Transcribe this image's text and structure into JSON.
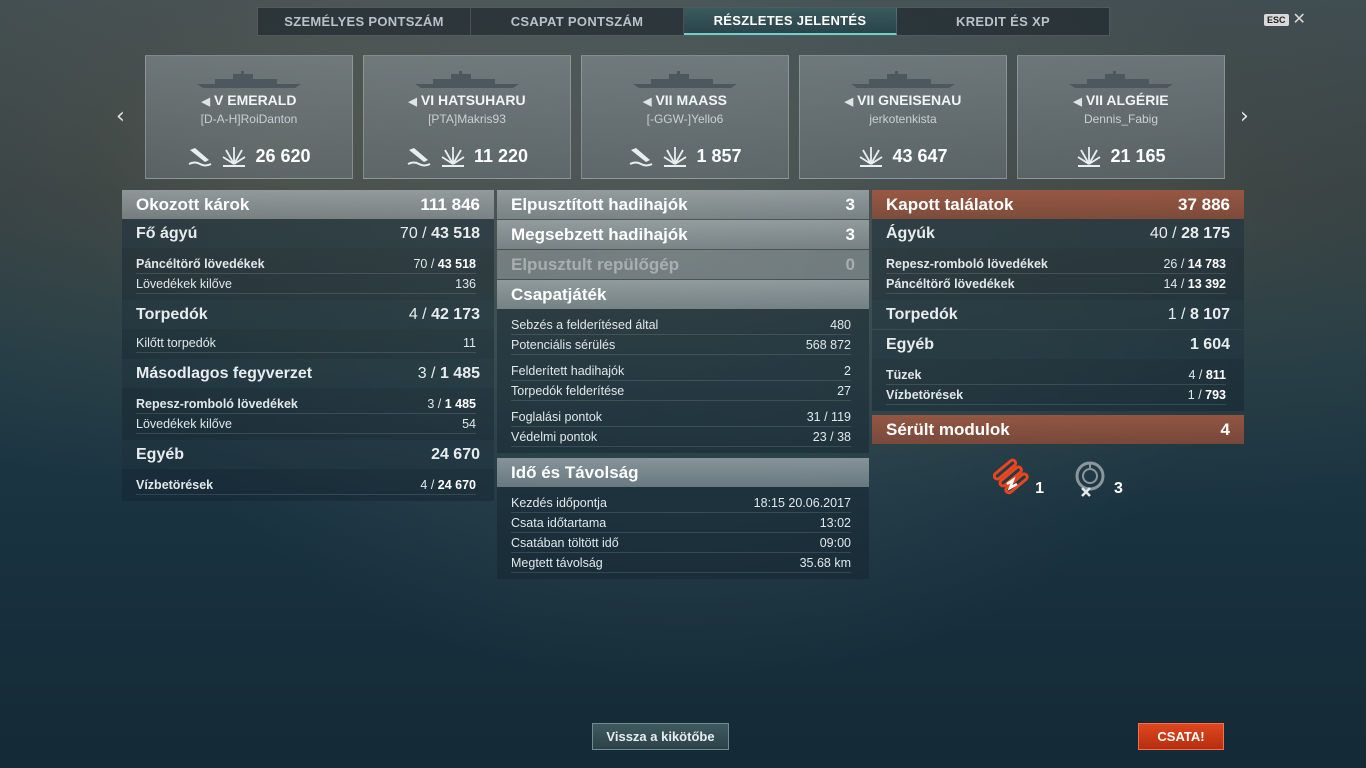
{
  "tabs": [
    {
      "label": "SZEMÉLYES PONTSZÁM",
      "active": false
    },
    {
      "label": "CSAPAT PONTSZÁM",
      "active": false
    },
    {
      "label": "RÉSZLETES JELENTÉS",
      "active": true
    },
    {
      "label": "KREDIT ÉS XP",
      "active": false
    }
  ],
  "esc": {
    "key": "ESC",
    "close": "✕"
  },
  "nav": {
    "prev": "‹",
    "next": "›"
  },
  "ships": [
    {
      "tier": "V",
      "name": "EMERALD",
      "player": "[D-A-H]RoiDanton",
      "damage": "26 620",
      "sunk": true
    },
    {
      "tier": "VI",
      "name": "HATSUHARU",
      "player": "[PTA]Makris93",
      "damage": "11 220",
      "sunk": true
    },
    {
      "tier": "VII",
      "name": "MAASS",
      "player": "[-GGW-]Yello6",
      "damage": "1 857",
      "sunk": true
    },
    {
      "tier": "VII",
      "name": "GNEISENAU",
      "player": "jerkotenkista",
      "damage": "43 647",
      "sunk": false
    },
    {
      "tier": "VII",
      "name": "ALGÉRIE",
      "player": "Dennis_Fabig",
      "damage": "21 165",
      "sunk": false
    }
  ],
  "damage": {
    "title": "Okozott károk",
    "total": "111 846",
    "main": {
      "label": "Fő ágyú",
      "hits": "70",
      "value": "43 518"
    },
    "main_rows": [
      {
        "label": "Páncéltörő lövedékek",
        "hits": "70",
        "value": "43 518",
        "strong": true
      },
      {
        "label": "Lövedékek kilőve",
        "value": "136",
        "strong": false
      }
    ],
    "torp": {
      "label": "Torpedók",
      "hits": "4",
      "value": "42 173"
    },
    "torp_rows": [
      {
        "label": "Kilőtt torpedók",
        "value": "11"
      }
    ],
    "sec": {
      "label": "Másodlagos fegyverzet",
      "hits": "3",
      "value": "1 485"
    },
    "sec_rows": [
      {
        "label": "Repesz-romboló lövedékek",
        "hits": "3",
        "value": "1 485",
        "strong": true
      },
      {
        "label": "Lövedékek kilőve",
        "value": "54",
        "strong": false
      }
    ],
    "other": {
      "label": "Egyéb",
      "value": "24 670"
    },
    "other_rows": [
      {
        "label": "Vízbetörések",
        "hits": "4",
        "value": "24 670"
      }
    ]
  },
  "middle": {
    "destroyed": {
      "label": "Elpusztított hadihajók",
      "value": "3"
    },
    "damaged": {
      "label": "Megsebzett hadihajók",
      "value": "3"
    },
    "planes": {
      "label": "Elpusztult repülőgép",
      "value": "0"
    },
    "team": {
      "label": "Csapatjáték"
    },
    "team_rows": [
      {
        "label": "Sebzés a felderítésed által",
        "value": "480"
      },
      {
        "label": "Potenciális sérülés",
        "value": "568 872"
      },
      {
        "label": "Felderített hadihajók",
        "value": "2"
      },
      {
        "label": "Torpedók felderítése",
        "value": "27"
      },
      {
        "label": "Foglalási pontok",
        "value": "31 / 119"
      },
      {
        "label": "Védelmi pontok",
        "value": "23 / 38"
      }
    ],
    "time": {
      "label": "Idő és Távolság"
    },
    "time_rows": [
      {
        "label": "Kezdés időpontja",
        "value": "18:15  20.06.2017"
      },
      {
        "label": "Csata időtartama",
        "value": "13:02"
      },
      {
        "label": "Csatában töltött idő",
        "value": "09:00"
      },
      {
        "label": "Megtett távolság",
        "value": "35.68 km"
      }
    ]
  },
  "received": {
    "title": "Kapott találatok",
    "total": "37 886",
    "guns": {
      "label": "Ágyúk",
      "hits": "40",
      "value": "28 175"
    },
    "guns_rows": [
      {
        "label": "Repesz-romboló lövedékek",
        "hits": "26",
        "value": "14 783"
      },
      {
        "label": "Páncéltörő lövedékek",
        "hits": "14",
        "value": "13 392"
      }
    ],
    "torp": {
      "label": "Torpedók",
      "hits": "1",
      "value": "8 107"
    },
    "other": {
      "label": "Egyéb",
      "value": "1 604"
    },
    "other_rows": [
      {
        "label": "Tüzek",
        "hits": "4",
        "value": "811"
      },
      {
        "label": "Vízbetörések",
        "hits": "1",
        "value": "793"
      }
    ],
    "modules": {
      "label": "Sérült modulok",
      "value": "4"
    },
    "module_icons": [
      {
        "icon": "torpedo-tubes-icon",
        "count": "1"
      },
      {
        "icon": "turret-icon",
        "count": "3"
      }
    ]
  },
  "buttons": {
    "back": "Vissza a kikötőbe",
    "battle": "CSATA!"
  },
  "colors": {
    "accent": "#6fd0c8",
    "battle": "#d03a18",
    "received_header": "#a55a41"
  }
}
